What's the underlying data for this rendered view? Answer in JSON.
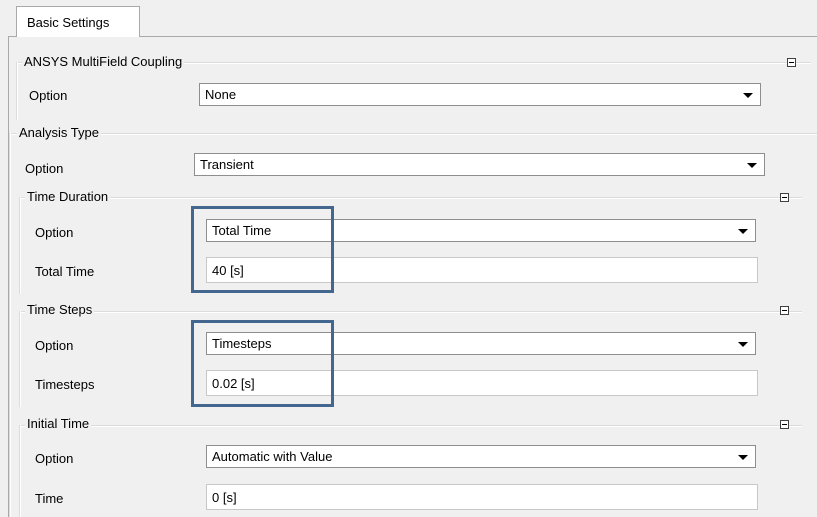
{
  "tab": {
    "label": "Basic Settings"
  },
  "multifield": {
    "title": "ANSYS MultiField Coupling",
    "option_label": "Option",
    "option_value": "None"
  },
  "analysis": {
    "title": "Analysis Type",
    "option_label": "Option",
    "option_value": "Transient"
  },
  "time_duration": {
    "title": "Time Duration",
    "option_label": "Option",
    "option_value": "Total Time",
    "total_time_label": "Total Time",
    "total_time_value": "40 [s]"
  },
  "time_steps": {
    "title": "Time Steps",
    "option_label": "Option",
    "option_value": "Timesteps",
    "timesteps_label": "Timesteps",
    "timesteps_value": "0.02 [s]"
  },
  "initial_time": {
    "title": "Initial Time",
    "option_label": "Option",
    "option_value": "Automatic with Value",
    "time_label": "Time",
    "time_value": "0 [s]"
  },
  "colors": {
    "highlight": "#44678f",
    "background": "#f0f0f0"
  },
  "icons": {
    "collapse": "collapse-minus-icon",
    "dropdown": "dropdown-arrow-icon"
  }
}
